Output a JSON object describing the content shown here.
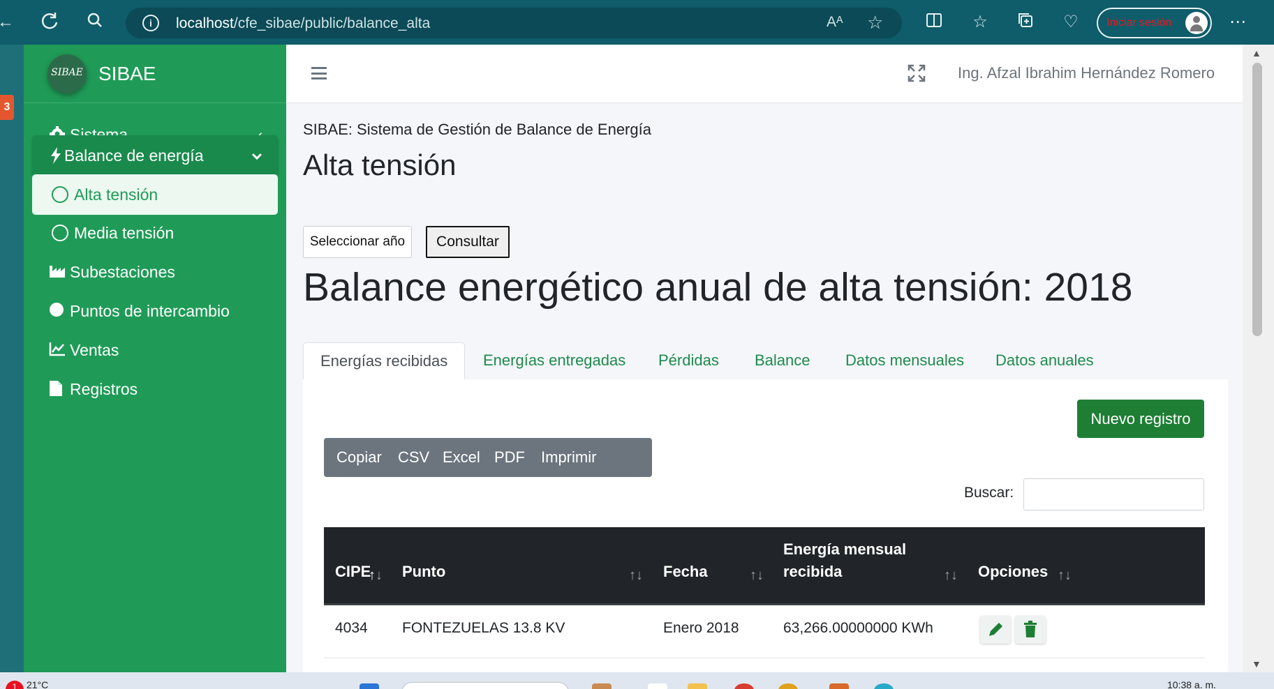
{
  "browser": {
    "url_host": "localhost",
    "url_path": "/cfe_sibae/public/balance_alta",
    "read_aloud_label": "Aᴬ",
    "signin_label": "Iniciar sesión"
  },
  "left_strip": {
    "badge": "3"
  },
  "sidebar": {
    "brand_logo_text": "SIBAE",
    "brand_name": "SIBAE",
    "items": [
      {
        "label": "Sistema",
        "icon": "gear-icon"
      },
      {
        "label": "Balance de energía",
        "icon": "bolt-icon"
      },
      {
        "label": "Alta tensión",
        "icon": "circle-outline-icon"
      },
      {
        "label": "Media tensión",
        "icon": "circle-outline-icon"
      },
      {
        "label": "Subestaciones",
        "icon": "industry-icon"
      },
      {
        "label": "Puntos de intercambio",
        "icon": "circle-filled-icon"
      },
      {
        "label": "Ventas",
        "icon": "line-chart-icon"
      },
      {
        "label": "Registros",
        "icon": "file-icon"
      }
    ]
  },
  "topbar": {
    "user_name": "Ing. Afzal Ibrahim Hernández Romero"
  },
  "header": {
    "subtitle": "SIBAE: Sistema de Gestión de Balance de Energía",
    "title": "Alta tensión"
  },
  "controls": {
    "select_year_label": "Seleccionar año",
    "query_label": "Consultar"
  },
  "report_title": "Balance energético anual de alta tensión: 2018",
  "tabs": [
    {
      "label": "Energías recibidas"
    },
    {
      "label": "Energías entregadas"
    },
    {
      "label": "Pérdidas"
    },
    {
      "label": "Balance"
    },
    {
      "label": "Datos mensuales"
    },
    {
      "label": "Datos anuales"
    }
  ],
  "table_card": {
    "new_record_label": "Nuevo registro",
    "export_buttons": [
      "Copiar",
      "CSV",
      "Excel",
      "PDF",
      "Imprimir"
    ],
    "search_label": "Buscar:",
    "search_value": "",
    "columns": [
      "CIPE",
      "Punto",
      "Fecha",
      "Energía mensual",
      "recibida",
      "Opciones"
    ],
    "rows": [
      {
        "cipe": "4034",
        "punto": "FONTEZUELAS 13.8 KV",
        "fecha": "Enero 2018",
        "energia": "63,266.00000000 KWh"
      }
    ]
  },
  "taskbar": {
    "badge": "1",
    "temperature": "21°C",
    "clock": "10:38 a. m."
  },
  "colors": {
    "sidebar_bg": "#1f9b57",
    "primary_green": "#1e7e34",
    "browser_bar": "#0f5c6a",
    "table_head": "#212529"
  }
}
